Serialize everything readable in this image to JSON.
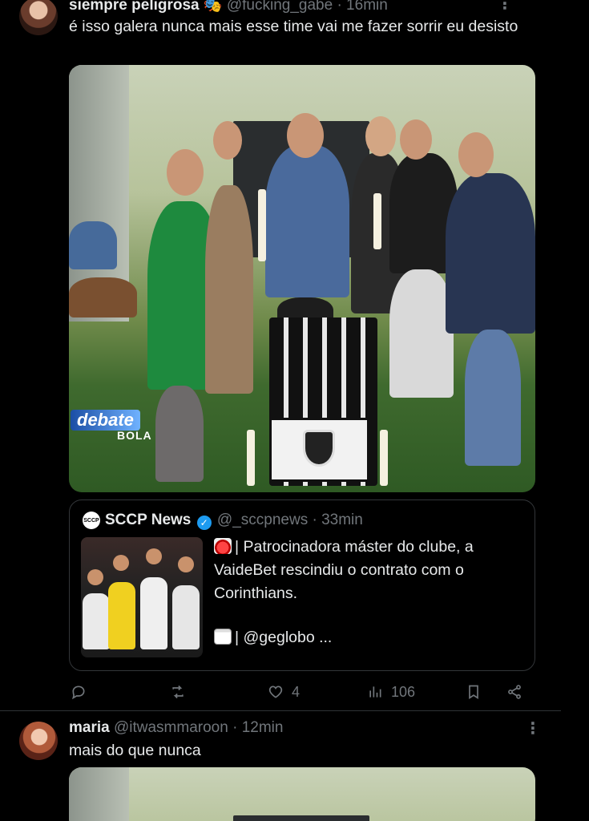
{
  "tweet1": {
    "display_name": "siempre peligrosa 🎭",
    "handle": "@fucking_gabe",
    "time": "· 16min",
    "text": "é isso galera nunca mais esse time vai me fazer sorrir eu desisto",
    "media_overlay": {
      "line1": "debate",
      "line2": "BOLA"
    },
    "quote": {
      "avatar_text": "SCCP",
      "display_name": "SCCP News",
      "handle": "@_sccpnews",
      "time": "· 33min",
      "text_line1": "| Patrocinadora máster do clube, a VaideBet rescindiu o contrato com o Corinthians.",
      "text_line2": "| @geglobo ..."
    },
    "actions": {
      "reply_count": "",
      "retweet_count": "",
      "like_count": "4",
      "view_count": "106"
    }
  },
  "tweet2": {
    "display_name": "maria",
    "handle": "@itwasmmaroon",
    "time": "· 12min",
    "text": "mais do que nunca"
  },
  "icons": [
    "reply-icon",
    "retweet-icon",
    "heart-icon",
    "views-icon",
    "bookmark-icon",
    "share-icon",
    "verified-icon",
    "more-icon"
  ],
  "colors": {
    "background": "#000000",
    "text": "#e7e9ea",
    "muted": "#71767b",
    "verified": "#1d9bf0",
    "border": "#333639"
  }
}
